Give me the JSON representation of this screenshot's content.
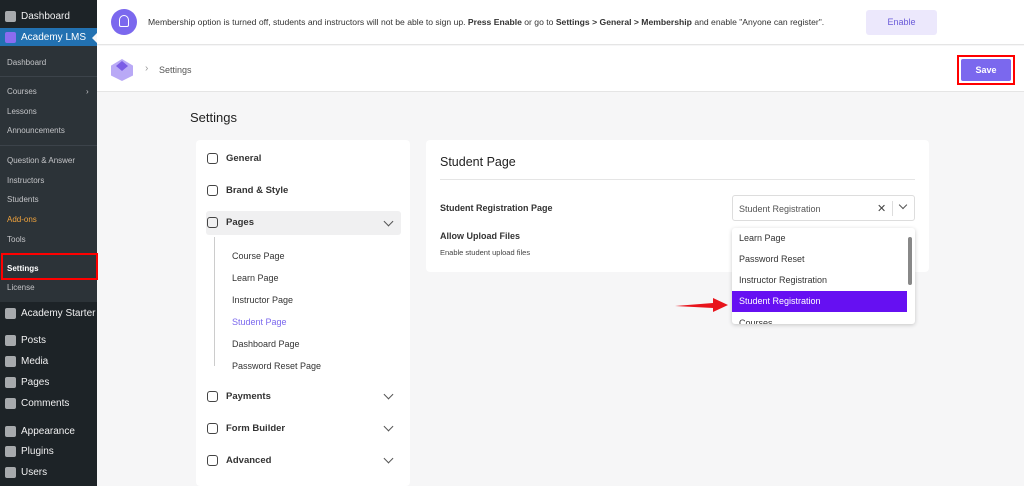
{
  "sidebar": {
    "top": [
      {
        "label": "Dashboard"
      },
      {
        "label": "Academy LMS"
      }
    ],
    "sub": [
      "Dashboard",
      "Courses",
      "Lessons",
      "Announcements",
      "Question & Answer",
      "Instructors",
      "Students",
      "Add-ons",
      "Tools",
      "Settings",
      "License"
    ],
    "bottom": [
      {
        "label": "Academy Starter"
      },
      {
        "label": "Posts"
      },
      {
        "label": "Media"
      },
      {
        "label": "Pages"
      },
      {
        "label": "Comments"
      },
      {
        "label": "Appearance"
      },
      {
        "label": "Plugins"
      },
      {
        "label": "Users"
      }
    ]
  },
  "notice": {
    "text_1": "Membership option is turned off, students and instructors will not be able to sign up. ",
    "bold_1": "Press Enable",
    "text_2": " or go to ",
    "bold_2": "Settings > General > Membership",
    "text_3": " and enable \"Anyone can register\".",
    "enable_label": "Enable"
  },
  "header": {
    "breadcrumb": "Settings",
    "save_label": "Save"
  },
  "page_title": "Settings",
  "nav": {
    "items": [
      {
        "label": "General"
      },
      {
        "label": "Brand & Style"
      },
      {
        "label": "Pages"
      },
      {
        "label": "Payments"
      },
      {
        "label": "Form Builder"
      },
      {
        "label": "Advanced"
      }
    ],
    "pages_sub": [
      "Course Page",
      "Learn Page",
      "Instructor Page",
      "Student Page",
      "Dashboard Page",
      "Password Reset Page"
    ]
  },
  "panel": {
    "title": "Student Page",
    "reg_label": "Student Registration Page",
    "reg_value": "Student Registration",
    "upload_label": "Allow Upload Files",
    "upload_desc": "Enable student upload files",
    "options": [
      "Learn Page",
      "Password Reset",
      "Instructor Registration",
      "Student Registration",
      "Courses"
    ]
  },
  "colors": {
    "accent": "#7b68ee",
    "selected": "#6610f2",
    "wp_blue": "#2271b1",
    "highlight_box": "#ff0000",
    "addon": "#f0a33c"
  }
}
